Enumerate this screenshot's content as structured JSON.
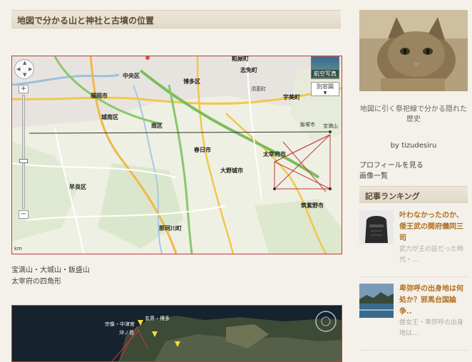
{
  "post": {
    "title": "地図で分かる山と神社と古墳の位置",
    "caption_line1": "宝満山・大城山・飯盛山",
    "caption_line2": "太宰府の四角形"
  },
  "map1": {
    "satellite_label": "航空写真",
    "separate_map_label": "別窓図",
    "scale_label": "km",
    "labels": {
      "chuo": "中央区",
      "fukuoka": "福岡市",
      "hakata": "博多区",
      "jonan": "城南区",
      "minami": "南区",
      "sawara": "早良区",
      "kasuga": "春日市",
      "onojo": "大野城市",
      "dazaifu": "太宰府市",
      "chikushino": "筑紫野市",
      "nakagawa": "那珂川町",
      "umi": "宇美町",
      "shime": "志免町",
      "kasuya": "粕屋町",
      "homan": "宝満山",
      "sue": "須恵町",
      "iizuka": "飯塚市"
    }
  },
  "map2": {
    "labels": {
      "genkai": "玄界・博多",
      "munakata": "宗像・中津宮",
      "okitsu": "沖ノ島"
    }
  },
  "sidebar": {
    "blog_title": "地図に引く祭祀線で分かる隠れた歴史",
    "byline": "by tizudesiru",
    "profile_link": "プロフィールを見る",
    "image_list_link": "画像一覧",
    "ranking_header": "記事ランキング",
    "ranking": [
      {
        "title": "叶わなかったのか、倭王武の開府儀同三司",
        "desc": "武力が王の証だった時代・..."
      },
      {
        "title": "卑弥呼の出身地は何処か？邪馬台国論争..",
        "desc": "倭女王・卑弥呼の出身地は..."
      }
    ]
  },
  "colors": {
    "accent_red": "#c23a3a",
    "ranking_title": "#b07020",
    "header_bg": "#e6dfce"
  }
}
